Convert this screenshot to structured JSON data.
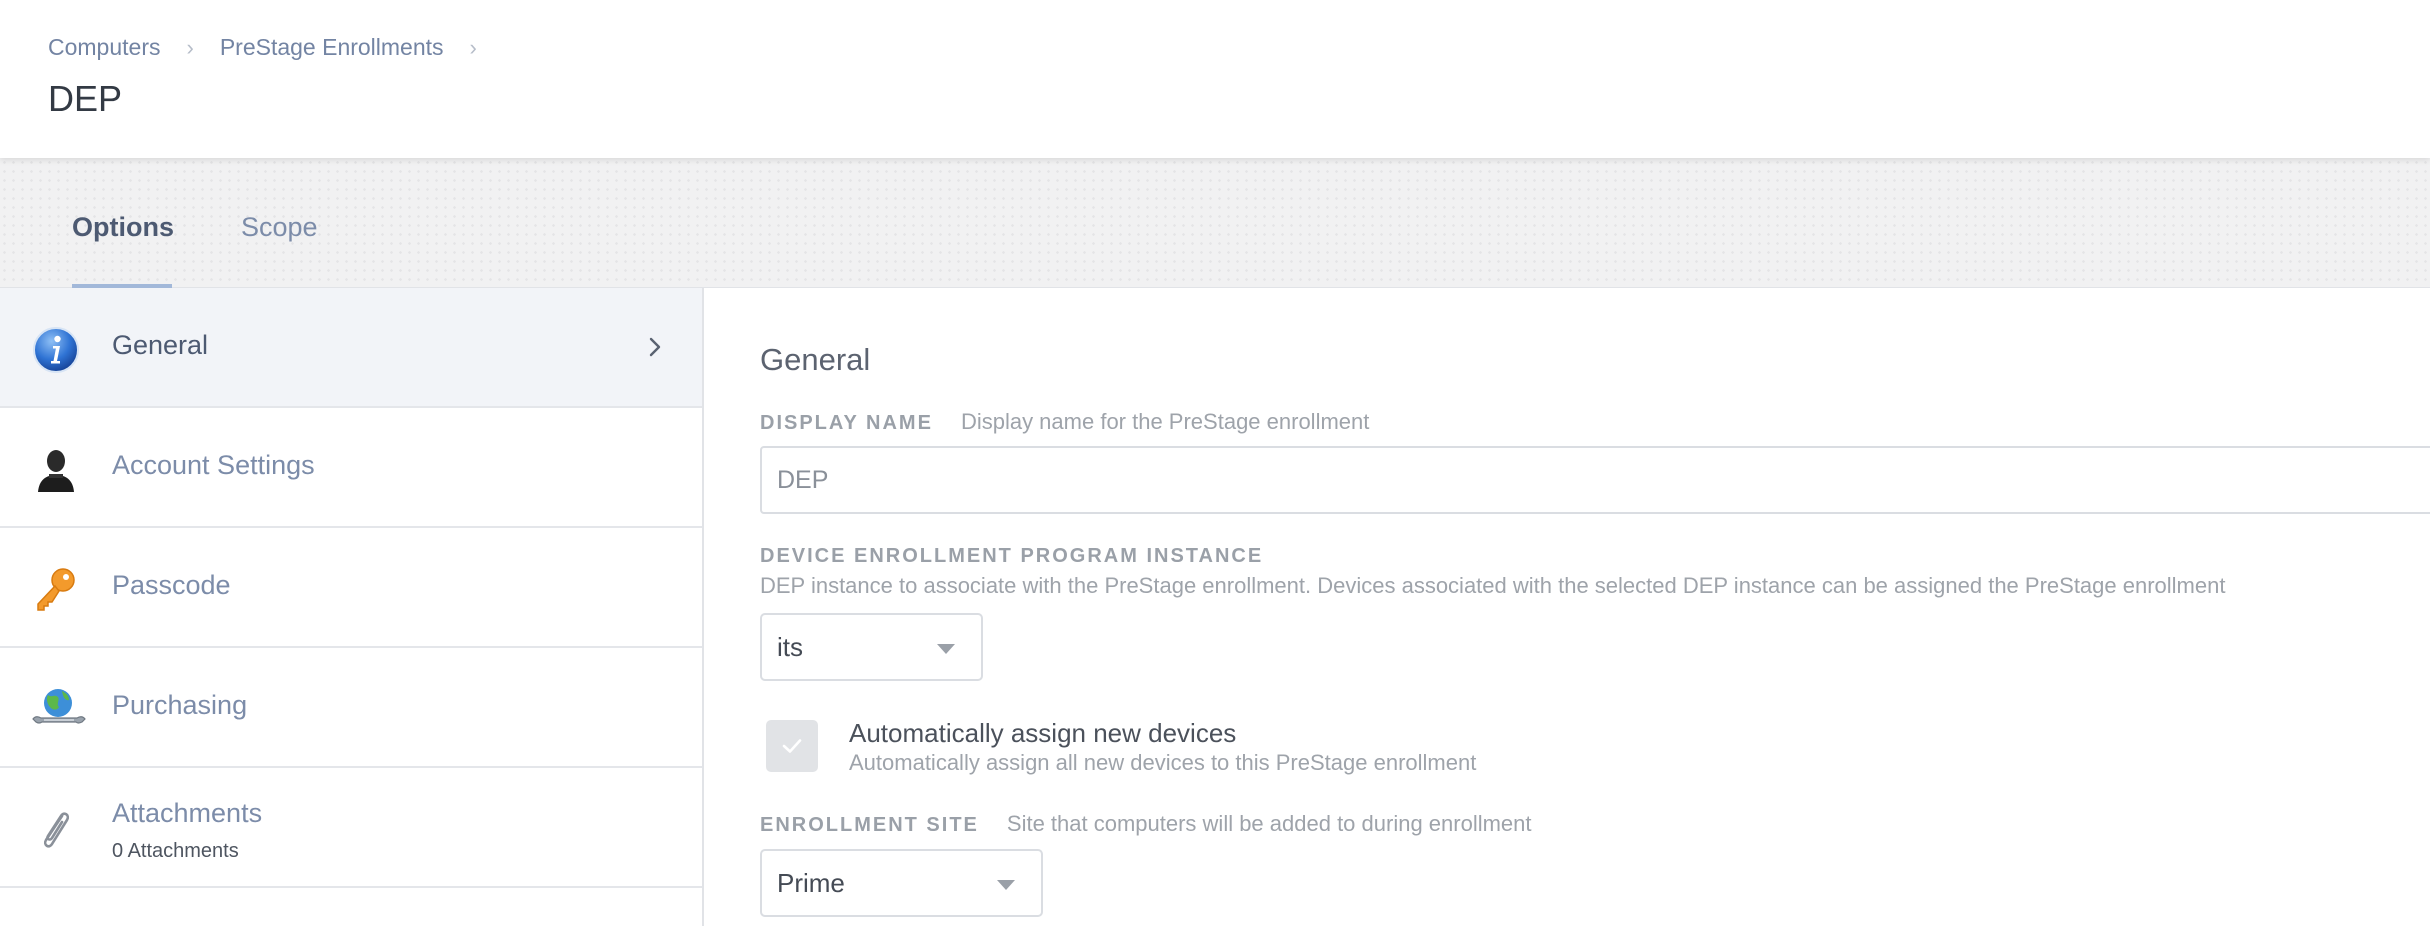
{
  "breadcrumb": {
    "items": [
      "Computers",
      "PreStage Enrollments"
    ],
    "separator": "›"
  },
  "page": {
    "title": "DEP"
  },
  "tabs": [
    {
      "label": "Options",
      "active": true
    },
    {
      "label": "Scope",
      "active": false
    }
  ],
  "sidebar": {
    "items": [
      {
        "label": "General",
        "icon": "info-icon",
        "active": true
      },
      {
        "label": "Account Settings",
        "icon": "user-icon"
      },
      {
        "label": "Passcode",
        "icon": "key-icon"
      },
      {
        "label": "Purchasing",
        "icon": "globe-wrench-icon"
      },
      {
        "label": "Attachments",
        "sublabel": "0 Attachments",
        "icon": "paperclip-icon"
      }
    ]
  },
  "main": {
    "section_title": "General",
    "display_name": {
      "label": "Display Name",
      "help": "Display name for the PreStage enrollment",
      "value": "DEP"
    },
    "dep_instance": {
      "label": "Device Enrollment Program Instance",
      "help": "DEP instance to associate with the PreStage enrollment. Devices associated with the selected DEP instance can be assigned the PreStage enrollment",
      "selected": "its"
    },
    "auto_assign": {
      "label": "Automatically assign new devices",
      "help": "Automatically assign all new devices to this PreStage enrollment",
      "checked": true
    },
    "enrollment_site": {
      "label": "Enrollment Site",
      "help": "Site that computers will be added to during enrollment",
      "selected": "Prime"
    }
  },
  "colors": {
    "link": "#7384a3",
    "tab_underline": "#a2b8d9",
    "sidebar_active_bg": "#f2f4f8",
    "label_gray": "#9aa0a8"
  }
}
